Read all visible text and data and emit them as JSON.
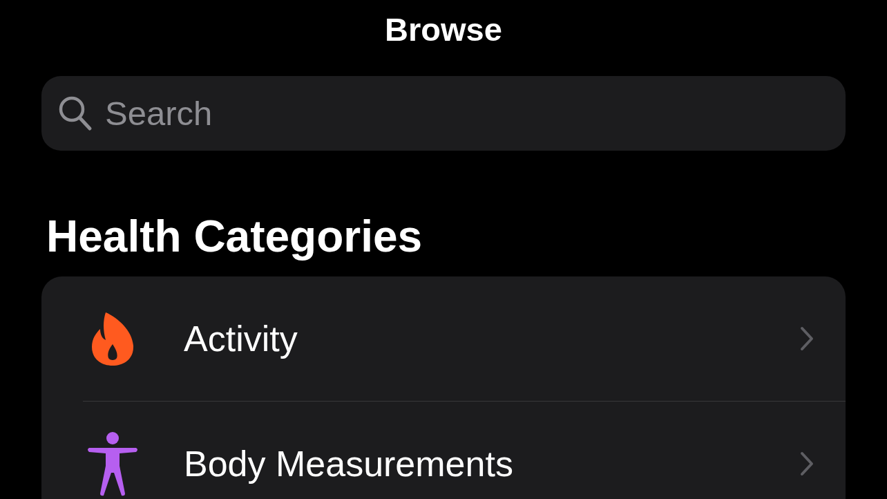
{
  "navigation_bar": {
    "title": "Browse"
  },
  "search": {
    "placeholder": "Search"
  },
  "section": {
    "title": "Health Categories",
    "items": [
      {
        "label": "Activity",
        "color": "#ff5a1f"
      },
      {
        "label": "Body Measurements",
        "color": "#b65ff0"
      }
    ]
  }
}
